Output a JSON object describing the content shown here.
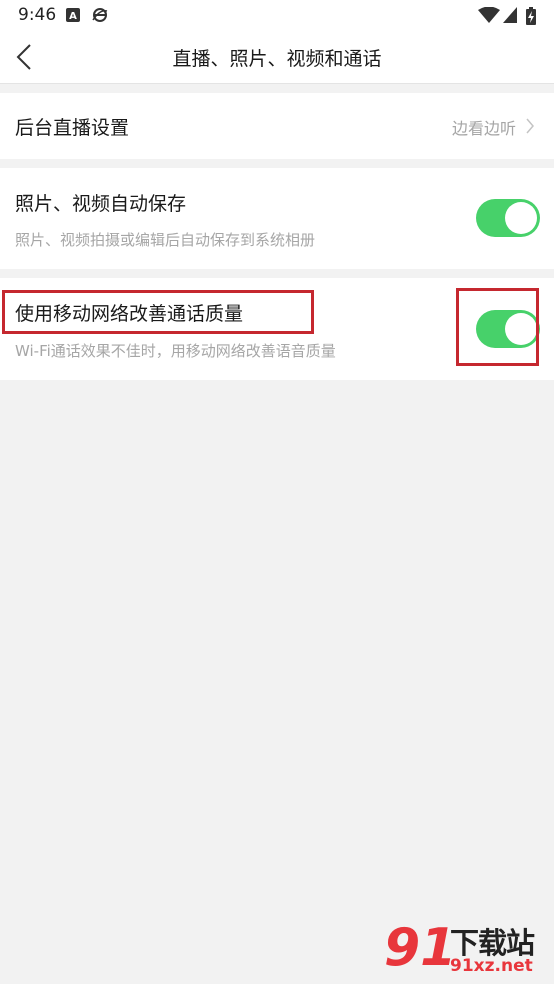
{
  "status_bar": {
    "time": "9:46",
    "icons": [
      "app-a-icon",
      "browser-e-icon",
      "wifi-icon",
      "signal-icon",
      "battery-charging-icon"
    ]
  },
  "nav": {
    "title": "直播、照片、视频和通话",
    "back_icon": "chevron-left-icon"
  },
  "settings": {
    "background_live": {
      "label": "后台直播设置",
      "value": "边看边听"
    },
    "auto_save": {
      "title": "照片、视频自动保存",
      "subtitle": "照片、视频拍摄或编辑后自动保存到系统相册",
      "enabled": true
    },
    "mobile_call": {
      "title": "使用移动网络改善通话质量",
      "subtitle": "Wi-Fi通话效果不佳时，用移动网络改善语音质量",
      "enabled": true
    }
  },
  "colors": {
    "toggle_on": "#47d16a",
    "highlight": "#c5282f",
    "watermark": "#e8363c"
  },
  "watermark": {
    "number": "91",
    "text": "下载站",
    "url": "91xz.net"
  }
}
